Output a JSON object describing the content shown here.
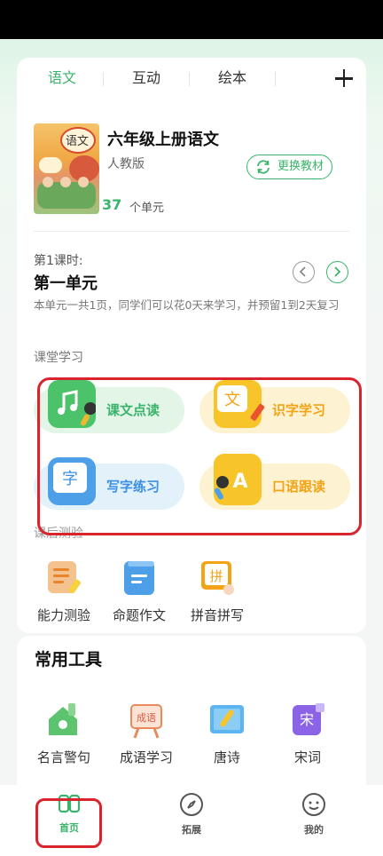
{
  "tabs": [
    "语文",
    "互动",
    "绘本"
  ],
  "book": {
    "title": "六年级上册语文",
    "publisher": "人教版",
    "unit_count": "37",
    "unit_label": "个单元",
    "change_label": "更换教材",
    "cover_text": "语文"
  },
  "lesson": {
    "label": "第1课时:",
    "title": "第一单元",
    "description": "本单元一共1页，同学们可以花0天来学习，并预留1到2天复习"
  },
  "classroom_label": "课堂学习",
  "classroom_items": [
    "课文点读",
    "识字学习",
    "写字练习",
    "口语跟读"
  ],
  "icon_glyphs": {
    "literacy": "文",
    "writing": "字",
    "speaking": "A",
    "pinyin": "拼",
    "idiom": "成语",
    "song": "宋"
  },
  "after_class_label": "课后测验",
  "after_class_items": [
    "能力测验",
    "命题作文",
    "拼音拼写"
  ],
  "tools": {
    "title": "常用工具",
    "items": [
      "名言警句",
      "成语学习",
      "唐诗",
      "宋词"
    ]
  },
  "bottom_nav": [
    "首页",
    "拓展",
    "我的"
  ],
  "colors": {
    "accent": "#3bb46b",
    "highlight": "#d9232d",
    "yellow": "#f2a316",
    "blue": "#3b8fe4"
  }
}
